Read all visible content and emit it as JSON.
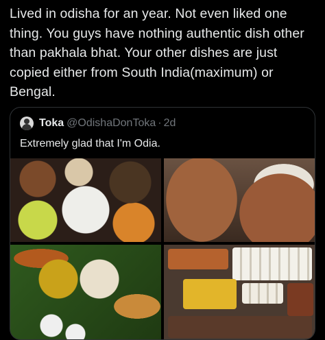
{
  "post": {
    "text": "Lived in odisha for an year. Not even liked one thing. You guys have nothing authentic dish other than pakhala bhat. Your other dishes are just copied either from South India(maximum) or Bengal."
  },
  "quote": {
    "author_name": "Toka",
    "author_handle": "@OdishaDonToka",
    "separator": "·",
    "time": "2d",
    "text": "Extremely glad that I'm Odia."
  },
  "colors": {
    "background": "#000000",
    "text": "#e7e9ea",
    "muted": "#71767b",
    "border": "#2f3336"
  },
  "icons": {
    "avatar": "user-avatar"
  }
}
